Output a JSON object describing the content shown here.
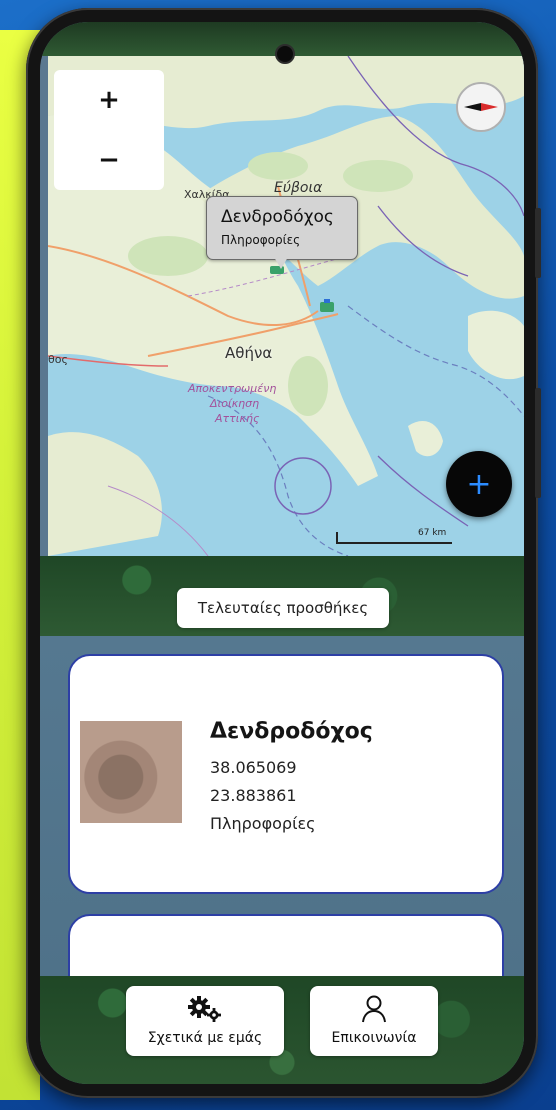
{
  "map": {
    "zoom_in_label": "+",
    "zoom_out_label": "−",
    "popup_title": "Δενδροδόχος",
    "popup_subtitle": "Πληροφορίες",
    "place_labels": {
      "chalkida": "Χαλκίδα",
      "evia": "Εύβοια",
      "athens": "Αθήνα",
      "region_line1": "Αποκεντρωμένη",
      "region_line2": "Διοίκηση",
      "region_line3": "Αττικής",
      "edge_fragment": "θος"
    },
    "scale_label": "67 km",
    "add_button_label": "+"
  },
  "recent": {
    "button_label": "Τελευταίες προσθήκες"
  },
  "cards": [
    {
      "title": "Δενδροδόχος",
      "latitude": "38.065069",
      "longitude": "23.883861",
      "info_label": "Πληροφορίες"
    }
  ],
  "nav": {
    "about_label": "Σχετικά με εμάς",
    "contact_label": "Επικοινωνία"
  },
  "colors": {
    "card_border": "#2d3fa5",
    "fab_background": "#070707",
    "fab_icon": "#2c8cff",
    "list_background": "#557890"
  },
  "icons": {
    "zoom_in": "plus-icon",
    "zoom_out": "minus-icon",
    "compass": "compass-icon",
    "marker": "tree-marker-icon",
    "about": "gears-icon",
    "contact": "user-icon"
  }
}
